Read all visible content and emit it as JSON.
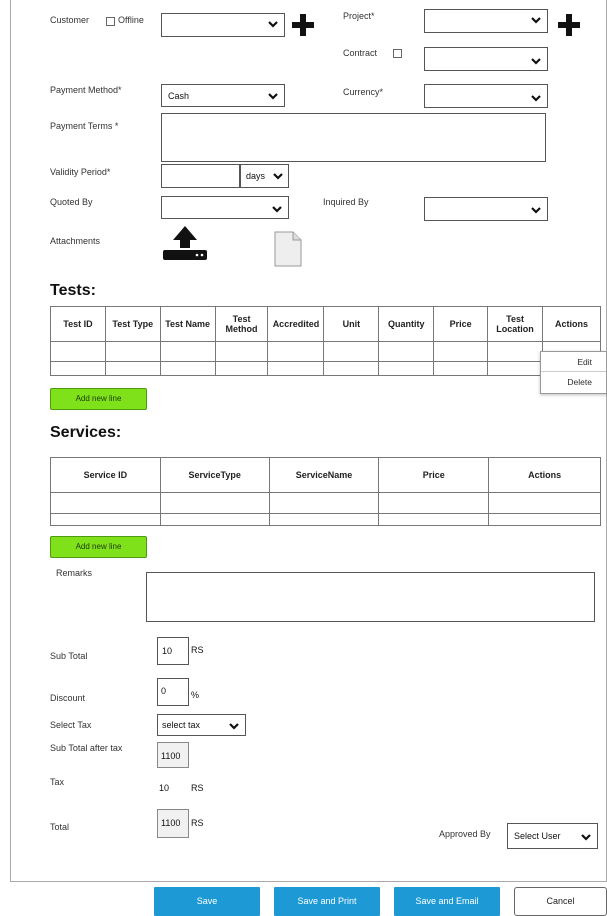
{
  "customer": {
    "label": "Customer",
    "offline_label": "Offline",
    "value": ""
  },
  "project": {
    "label": "Project*",
    "value": ""
  },
  "contract": {
    "label": "Contract",
    "value": ""
  },
  "payment_method": {
    "label": "Payment Method*",
    "value": "Cash"
  },
  "currency": {
    "label": "Currency*",
    "value": ""
  },
  "payment_terms": {
    "label": "Payment Terms *",
    "value": ""
  },
  "validity_period": {
    "label": "Validity Period*",
    "value": "",
    "unit": "days"
  },
  "quoted_by": {
    "label": "Quoted By",
    "value": ""
  },
  "inquired_by": {
    "label": "Inquired By",
    "value": ""
  },
  "attachments": {
    "label": "Attachments"
  },
  "tests": {
    "heading": "Tests:",
    "columns": [
      "Test ID",
      "Test Type",
      "Test Name",
      "Test Method",
      "Accredited",
      "Unit",
      "Quantity",
      "Price",
      "Test Location",
      "Actions"
    ],
    "add_label": "Add new line",
    "context_menu": [
      "Edit",
      "Delete"
    ]
  },
  "services": {
    "heading": "Services:",
    "columns": [
      "Service ID",
      "ServiceType",
      "ServiceName",
      "Price",
      "Actions"
    ],
    "add_label": "Add new line"
  },
  "remarks": {
    "label": "Remarks",
    "value": ""
  },
  "sub_total": {
    "label": "Sub Total",
    "value": "10",
    "unit": "RS"
  },
  "discount": {
    "label": "Discount",
    "value": "0",
    "unit": "%"
  },
  "select_tax": {
    "label": "Select Tax",
    "value": "select tax"
  },
  "sub_total_after_tax": {
    "label": "Sub Total after tax",
    "value": "1100"
  },
  "tax": {
    "label": "Tax",
    "value": "10",
    "unit": "RS"
  },
  "total": {
    "label": "Total",
    "value": "1100",
    "unit": "RS"
  },
  "approved_by": {
    "label": "Approved By",
    "value": "Select User"
  },
  "buttons": {
    "save": "Save",
    "save_print": "Save and Print",
    "save_email": "Save and Email",
    "cancel": "Cancel"
  },
  "colors": {
    "primary_button": "#1d9ad6",
    "add_line_button": "#7fe11a"
  }
}
